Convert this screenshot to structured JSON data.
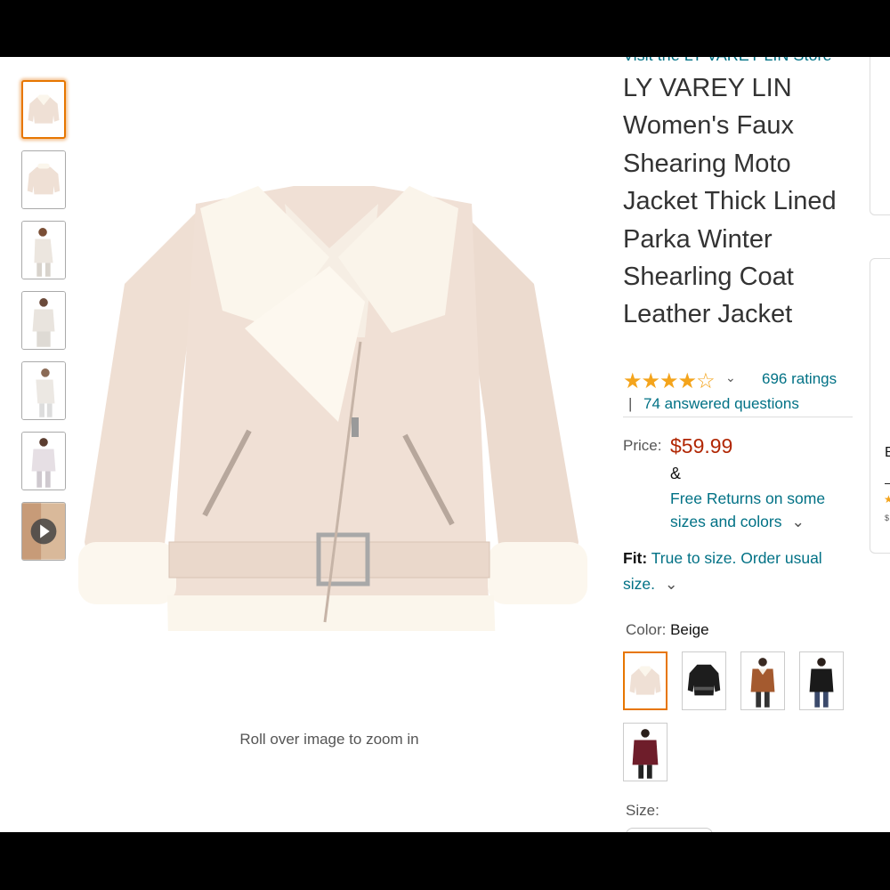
{
  "store": {
    "link": "Visit the LY VAREY LIN Store"
  },
  "product": {
    "title": "LY VAREY LIN Women's Faux Shearing Moto Jacket Thick Lined Parka Winter Shearling Coat Leather Jacket",
    "stars": "★★★★☆",
    "rating_value": 4.2,
    "ratings_count": "696 ratings",
    "qa_sep": "|",
    "answered_questions": "74 answered questions",
    "price_label": "Price:",
    "price": "$59.99",
    "amp": "&",
    "returns": "Free Returns on some sizes and colors",
    "fit_label": "Fit:",
    "fit_text": "True to size. Order usual size.",
    "color_label": "Color:",
    "color_value": "Beige",
    "size_label": "Size:"
  },
  "gallery": {
    "zoom_hint": "Roll over image to zoom in",
    "thumbnails": [
      "jacket-front",
      "jacket-back",
      "model-1",
      "model-2",
      "model-3",
      "model-4",
      "video"
    ],
    "selected_index": 0
  },
  "swatches": {
    "options": [
      "Beige",
      "Black",
      "Brown",
      "Black-model",
      "Burgundy"
    ],
    "selected_index": 0
  },
  "edge": {
    "letter": "E",
    "dash": "–",
    "star": "★",
    "price": "$"
  },
  "colors": {
    "link": "#007185",
    "price": "#b12704",
    "star": "#f4a41c",
    "selection": "#e77600",
    "jacket": "#f0e1d6",
    "fleece": "#fbf6ec"
  }
}
